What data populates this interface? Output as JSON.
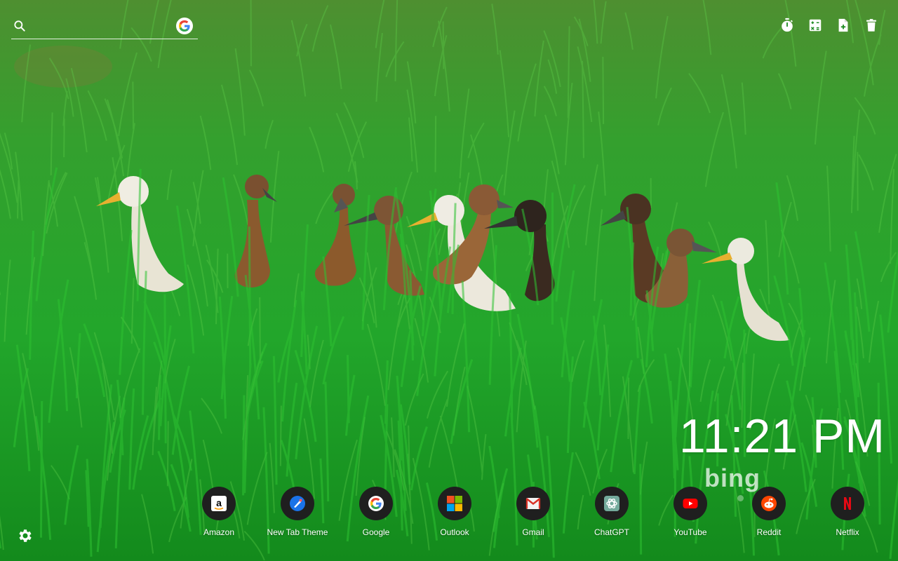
{
  "search": {
    "value": "",
    "placeholder": "",
    "engine_icon": "google-g-icon"
  },
  "toolbar": {
    "icons": [
      "timer-icon",
      "calculator-icon",
      "add-file-icon",
      "trash-icon"
    ]
  },
  "clock": {
    "time": "11:21 PM"
  },
  "wallpaper": {
    "source_logo": "bing"
  },
  "shortcuts": [
    {
      "label": "Amazon",
      "icon": "amazon-icon"
    },
    {
      "label": "New Tab Theme",
      "icon": "new-tab-theme-icon"
    },
    {
      "label": "Google",
      "icon": "google-icon"
    },
    {
      "label": "Outlook",
      "icon": "microsoft-icon"
    },
    {
      "label": "Gmail",
      "icon": "gmail-icon"
    },
    {
      "label": "ChatGPT",
      "icon": "chatgpt-icon"
    },
    {
      "label": "YouTube",
      "icon": "youtube-icon"
    },
    {
      "label": "Reddit",
      "icon": "reddit-icon"
    },
    {
      "label": "Netflix",
      "icon": "netflix-icon"
    }
  ],
  "settings": {
    "icon": "gear-icon"
  },
  "colors": {
    "grass": "#22a02a",
    "tile": "#1f1f1f",
    "text": "#ffffff",
    "youtube": "#ff0000",
    "reddit": "#ff4500",
    "netflix": "#e50914",
    "new_tab_theme": "#1a73e8"
  }
}
